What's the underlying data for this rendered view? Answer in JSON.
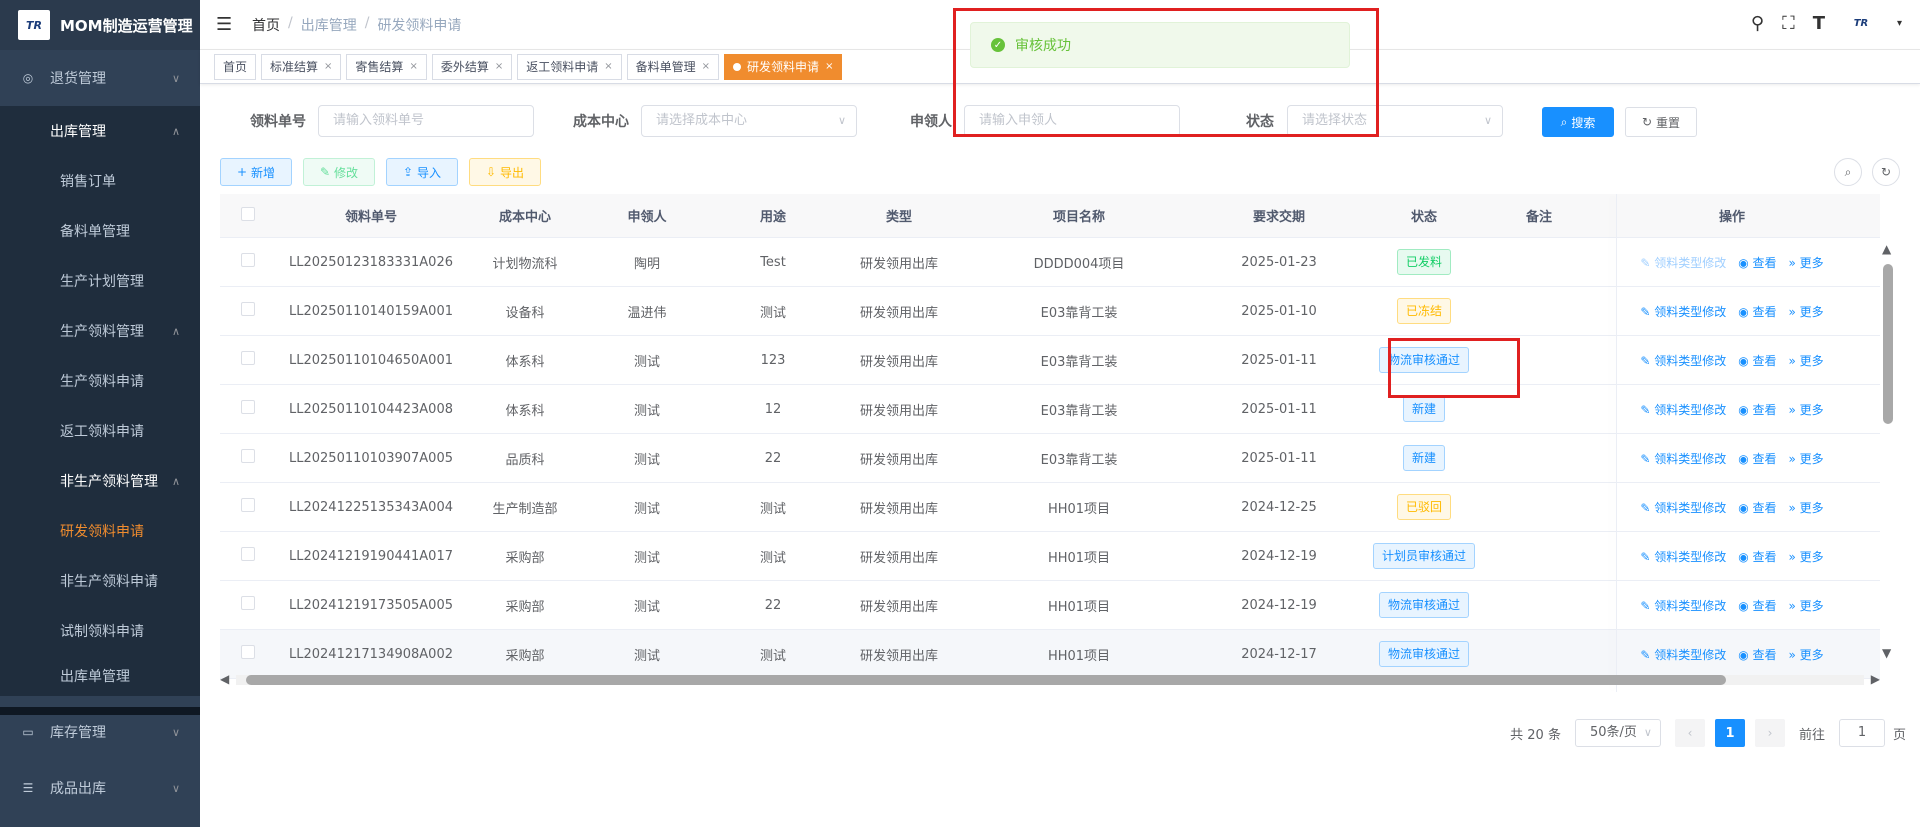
{
  "app": {
    "title": "MOM制造运营管理",
    "logo_text": "TR"
  },
  "sidebar": {
    "items": [
      {
        "label": "退货管理",
        "icon": "return-icon"
      },
      {
        "label": "出库管理"
      },
      {
        "label": "销售订单"
      },
      {
        "label": "备料单管理"
      },
      {
        "label": "生产计划管理"
      },
      {
        "label": "生产领料管理"
      },
      {
        "label": "生产领料申请"
      },
      {
        "label": "返工领料申请"
      },
      {
        "label": "非生产领料管理"
      },
      {
        "label": "研发领料申请"
      },
      {
        "label": "非生产领料申请"
      },
      {
        "label": "试制领料申请"
      },
      {
        "label": "出库单管理"
      },
      {
        "label": "库存管理",
        "icon": "monitor-icon"
      },
      {
        "label": "成品出库",
        "icon": "list-icon"
      }
    ]
  },
  "breadcrumb": {
    "home": "首页",
    "level2": "出库管理",
    "current": "研发领料申请"
  },
  "tags": [
    "首页",
    "标准结算",
    "寄售结算",
    "委外结算",
    "返工领料申请",
    "备料单管理",
    "研发领料申请"
  ],
  "toast": {
    "message": "审核成功"
  },
  "search": {
    "field1_label": "领料单号",
    "field1_placeholder": "请输入领料单号",
    "field2_label": "成本中心",
    "field2_placeholder": "请选择成本中心",
    "field3_label": "申领人",
    "field3_placeholder": "请输入申领人",
    "field4_label": "状态",
    "field4_placeholder": "请选择状态",
    "search_btn": "搜索",
    "reset_btn": "重置"
  },
  "toolbar": {
    "add": "新增",
    "edit": "修改",
    "import": "导入",
    "export": "导出"
  },
  "table": {
    "headers": [
      "领料单号",
      "成本中心",
      "申领人",
      "用途",
      "类型",
      "项目名称",
      "要求交期",
      "状态",
      "备注",
      "操作"
    ],
    "rows": [
      {
        "no": "LL20250123183331A026",
        "center": "计划物流科",
        "person": "陶明",
        "purpose": "Test",
        "type": "研发领用出库",
        "project": "DDDD004项目",
        "date": "2025-01-23",
        "status": "已发料",
        "status_color": "green"
      },
      {
        "no": "LL20250110140159A001",
        "center": "设备科",
        "person": "温进伟",
        "purpose": "测试",
        "type": "研发领用出库",
        "project": "E03靠背工装",
        "date": "2025-01-10",
        "status": "已冻结",
        "status_color": "orange"
      },
      {
        "no": "LL20250110104650A001",
        "center": "体系科",
        "person": "测试",
        "purpose": "123",
        "type": "研发领用出库",
        "project": "E03靠背工装",
        "date": "2025-01-11",
        "status": "物流审核通过",
        "status_color": "blue"
      },
      {
        "no": "LL20250110104423A008",
        "center": "体系科",
        "person": "测试",
        "purpose": "12",
        "type": "研发领用出库",
        "project": "E03靠背工装",
        "date": "2025-01-11",
        "status": "新建",
        "status_color": "blue"
      },
      {
        "no": "LL20250110103907A005",
        "center": "品质科",
        "person": "测试",
        "purpose": "22",
        "type": "研发领用出库",
        "project": "E03靠背工装",
        "date": "2025-01-11",
        "status": "新建",
        "status_color": "blue"
      },
      {
        "no": "LL20241225135343A004",
        "center": "生产制造部",
        "person": "测试",
        "purpose": "测试",
        "type": "研发领用出库",
        "project": "HH01项目",
        "date": "2024-12-25",
        "status": "已驳回",
        "status_color": "orange"
      },
      {
        "no": "LL20241219190441A017",
        "center": "采购部",
        "person": "测试",
        "purpose": "测试",
        "type": "研发领用出库",
        "project": "HH01项目",
        "date": "2024-12-19",
        "status": "计划员审核通过",
        "status_color": "blue"
      },
      {
        "no": "LL20241219173505A005",
        "center": "采购部",
        "person": "测试",
        "purpose": "22",
        "type": "研发领用出库",
        "project": "HH01项目",
        "date": "2024-12-19",
        "status": "物流审核通过",
        "status_color": "blue"
      },
      {
        "no": "LL20241217134908A002",
        "center": "采购部",
        "person": "测试",
        "purpose": "测试",
        "type": "研发领用出库",
        "project": "HH01项目",
        "date": "2024-12-17",
        "status": "物流审核通过",
        "status_color": "blue"
      }
    ],
    "ops": {
      "modify": "领料类型修改",
      "view": "查看",
      "more": "更多"
    }
  },
  "pagination": {
    "total": "共 20 条",
    "page_size": "50条/页",
    "current": "1",
    "goto_prefix": "前往",
    "goto_value": "1",
    "goto_suffix": "页"
  }
}
